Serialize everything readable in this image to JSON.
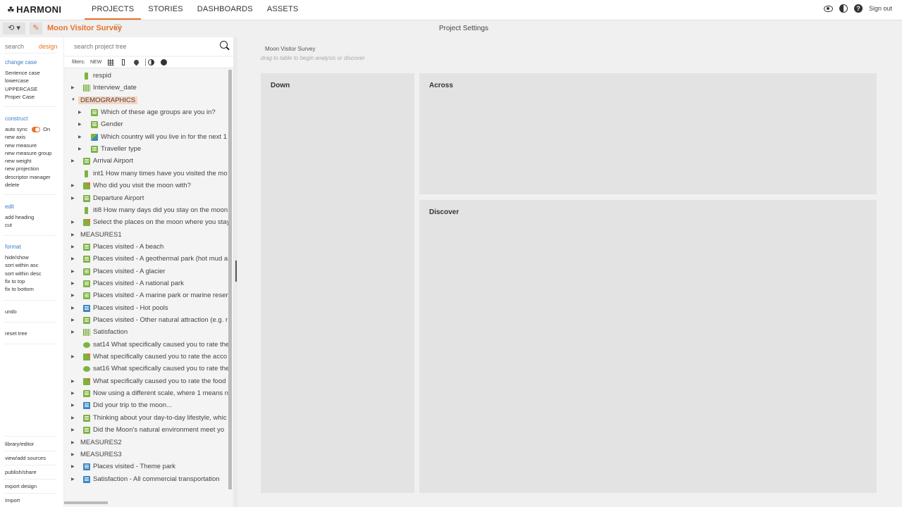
{
  "app": {
    "logo_text": "HARMONI",
    "nav": [
      "PROJECTS",
      "STORIES",
      "DASHBOARDS",
      "ASSETS"
    ],
    "sign_out": "Sign out"
  },
  "subbar": {
    "project_title": "Moon Visitor Survey",
    "center_label": "Project Settings"
  },
  "leftbar": {
    "tab_search": "search",
    "tab_design": "design",
    "change_case": {
      "heading": "change case",
      "items": [
        "Sentence case",
        "lowercase",
        "UPPERCASE",
        "Proper Case"
      ]
    },
    "construct": {
      "heading": "construct",
      "auto_sync_label": "auto sync",
      "auto_sync_value": "On",
      "items": [
        "new axis",
        "new measure",
        "new measure group",
        "new weight",
        "new projection",
        "descriptor manager",
        "delete"
      ]
    },
    "edit": {
      "heading": "edit",
      "items": [
        "add heading",
        "cut"
      ]
    },
    "format": {
      "heading": "format",
      "items": [
        "hide/show",
        "sort within asc",
        "sort within desc",
        "fix to top",
        "fix to bottom"
      ]
    },
    "undo": "undo",
    "reset_tree": "reset tree",
    "bottom_links": [
      "library/editor",
      "view/add sources",
      "publish/share",
      "export design",
      "Import"
    ]
  },
  "tree": {
    "search_placeholder": "search project tree",
    "filters_label": "filters:",
    "filters_new": "NEW",
    "rows": [
      {
        "label": "respid",
        "indent": 1,
        "caret": false,
        "icon": "num"
      },
      {
        "label": "Interview_date",
        "indent": 1,
        "caret": true,
        "icon": "grid"
      },
      {
        "label": "DEMOGRAPHICS",
        "indent": 0,
        "caret": true,
        "open": true,
        "icon": "none",
        "highlight": true
      },
      {
        "label": "Which of these age groups are you in?",
        "indent": 2,
        "caret": true,
        "icon": "green"
      },
      {
        "label": "Gender",
        "indent": 2,
        "caret": true,
        "icon": "green"
      },
      {
        "label": "Which country will you live in for the next 1",
        "indent": 2,
        "caret": true,
        "icon": "mix"
      },
      {
        "label": "Traveller type",
        "indent": 2,
        "caret": true,
        "icon": "green"
      },
      {
        "label": "Arrival Airport",
        "indent": 1,
        "caret": true,
        "icon": "green"
      },
      {
        "label": "int1 How many times have you visited the mo",
        "indent": 1,
        "caret": false,
        "icon": "num"
      },
      {
        "label": "Who did you visit the moon with?",
        "indent": 1,
        "caret": true,
        "icon": "orange"
      },
      {
        "label": "Departure Airport",
        "indent": 1,
        "caret": true,
        "icon": "green"
      },
      {
        "label": "iti8 How many days did you stay on the moon",
        "indent": 1,
        "caret": false,
        "icon": "num"
      },
      {
        "label": "Select the places on the moon where you stay",
        "indent": 1,
        "caret": true,
        "icon": "orange"
      },
      {
        "label": "MEASURES1",
        "indent": 0,
        "caret": true,
        "icon": "none"
      },
      {
        "label": "Places visited - A beach",
        "indent": 1,
        "caret": true,
        "icon": "green"
      },
      {
        "label": "Places visited - A geothermal park (hot mud a",
        "indent": 1,
        "caret": true,
        "icon": "green"
      },
      {
        "label": "Places visited - A glacier",
        "indent": 1,
        "caret": true,
        "icon": "green"
      },
      {
        "label": "Places visited - A national park",
        "indent": 1,
        "caret": true,
        "icon": "green"
      },
      {
        "label": "Places visited - A marine park or marine reser",
        "indent": 1,
        "caret": true,
        "icon": "green"
      },
      {
        "label": "Places visited - Hot pools",
        "indent": 1,
        "caret": true,
        "icon": "blue"
      },
      {
        "label": "Places visited - Other natural attraction (e.g. r",
        "indent": 1,
        "caret": true,
        "icon": "green"
      },
      {
        "label": "Satisfaction",
        "indent": 1,
        "caret": true,
        "icon": "grid"
      },
      {
        "label": "sat14 What specifically caused you to rate the",
        "indent": 1,
        "caret": false,
        "icon": "speech"
      },
      {
        "label": "What specifically caused you to rate the acco",
        "indent": 1,
        "caret": true,
        "icon": "orange"
      },
      {
        "label": "sat16 What specifically caused you to rate the",
        "indent": 1,
        "caret": false,
        "icon": "speech"
      },
      {
        "label": "What specifically caused you to rate the food",
        "indent": 1,
        "caret": true,
        "icon": "orange"
      },
      {
        "label": "Now using a different scale, where 1 means n",
        "indent": 1,
        "caret": true,
        "icon": "green"
      },
      {
        "label": "Did your trip to the moon...",
        "indent": 1,
        "caret": true,
        "icon": "blue"
      },
      {
        "label": "Thinking about your day-to-day lifestyle, whic",
        "indent": 1,
        "caret": true,
        "icon": "green"
      },
      {
        "label": "Did the Moon's natural environment meet yo",
        "indent": 1,
        "caret": true,
        "icon": "green"
      },
      {
        "label": "MEASURES2",
        "indent": 0,
        "caret": true,
        "icon": "none"
      },
      {
        "label": "MEASURES3",
        "indent": 0,
        "caret": true,
        "icon": "none"
      },
      {
        "label": "Places visited - Theme park",
        "indent": 1,
        "caret": true,
        "icon": "blue"
      },
      {
        "label": "Satisfaction - All commercial transportation",
        "indent": 1,
        "caret": true,
        "icon": "blue"
      }
    ]
  },
  "canvas": {
    "title": "Moon Visitor Survey",
    "hint": "drag to table to begin analysis or discover",
    "down": "Down",
    "across": "Across",
    "discover": "Discover"
  },
  "colors": {
    "accent": "#e8732a",
    "link": "#3a7dc9",
    "tree_green": "#7cb342",
    "tree_blue": "#3a87c2"
  }
}
